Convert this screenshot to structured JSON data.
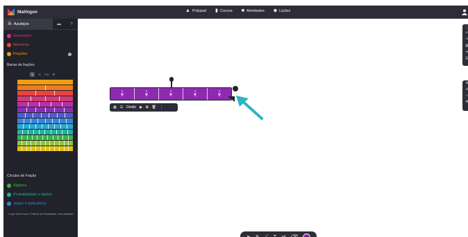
{
  "app": {
    "name": "Mathigon"
  },
  "nav": [
    {
      "label": "Polypad",
      "icon": "polypad-icon",
      "glyph": "▲"
    },
    {
      "label": "Cursos",
      "icon": "courses-icon",
      "glyph": "▮"
    },
    {
      "label": "Atividades",
      "icon": "activities-icon",
      "glyph": "■"
    },
    {
      "label": "Lições",
      "icon": "lessons-icon",
      "glyph": "◆"
    }
  ],
  "sidebar": {
    "tab_label": "Azulejos",
    "categories": [
      {
        "label": "Geometria",
        "color": "#e3327a"
      },
      {
        "label": "Números",
        "color": "#e74c3c"
      },
      {
        "label": "Frações",
        "color": "#f39c12"
      }
    ],
    "subsection_title": "Barras de frações",
    "format_options": [
      "%",
      "0.5",
      "⚙"
    ],
    "format_active": "1",
    "bar_rows": [
      {
        "n": 1,
        "color": "#f39c12"
      },
      {
        "n": 2,
        "color": "#f07b20"
      },
      {
        "n": 3,
        "color": "#e94342"
      },
      {
        "n": 4,
        "color": "#d63a74"
      },
      {
        "n": 5,
        "color": "#b233a7"
      },
      {
        "n": 6,
        "color": "#8530b3"
      },
      {
        "n": 7,
        "color": "#4f5bd1"
      },
      {
        "n": 8,
        "color": "#3c83d8"
      },
      {
        "n": 9,
        "color": "#2aa7d4"
      },
      {
        "n": 10,
        "color": "#20b29a"
      },
      {
        "n": 11,
        "color": "#3cb24a"
      },
      {
        "n": 12,
        "color": "#8cc43f"
      },
      {
        "n": 12,
        "color": "#e2c018"
      }
    ],
    "circles_title": "Círculos de Fração",
    "lower_categories": [
      {
        "label": "Álgebra",
        "color": "#3cb24a"
      },
      {
        "label": "Probabilidade e dados",
        "color": "#20b29a"
      },
      {
        "label": "Jogos e Aplicativos",
        "color": "#3c83d8"
      }
    ],
    "footer_text": "O que há de novo • Política de Privacidade • Uso aceitável"
  },
  "canvas": {
    "bar_segments": [
      "1/5",
      "1/5",
      "1/5",
      "1/5",
      "1/5"
    ],
    "bar_color": "#8e2ab0",
    "toolbar": {
      "divide_label": "Dividir"
    },
    "annotation_color": "#29b6c6"
  },
  "bottom_toolbar": {
    "tools": [
      "cursor-icon",
      "pen-icon",
      "line-icon",
      "text-icon",
      "equation-icon",
      "eraser-icon"
    ],
    "active_color": "#7f22a6"
  }
}
